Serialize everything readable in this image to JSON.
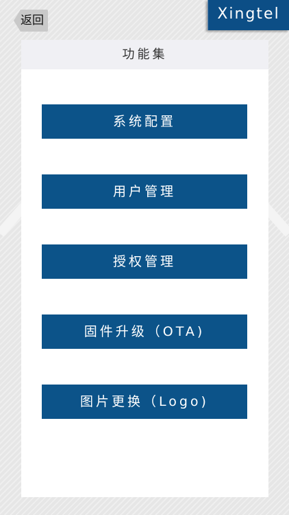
{
  "nav": {
    "back_label": "返回"
  },
  "brand": {
    "name": "Xingtel"
  },
  "panel": {
    "title": "功能集",
    "buttons": [
      {
        "label": "系统配置"
      },
      {
        "label": "用户管理"
      },
      {
        "label": "授权管理"
      },
      {
        "label": "固件升级（OTA)"
      },
      {
        "label": "图片更换（Logo)"
      }
    ]
  },
  "colors": {
    "primary": "#0c5389",
    "brand_bg": "#0c4e86",
    "panel_bg": "#ffffff",
    "header_bg": "#f0f0f4",
    "page_bg": "#e6e6e6"
  }
}
